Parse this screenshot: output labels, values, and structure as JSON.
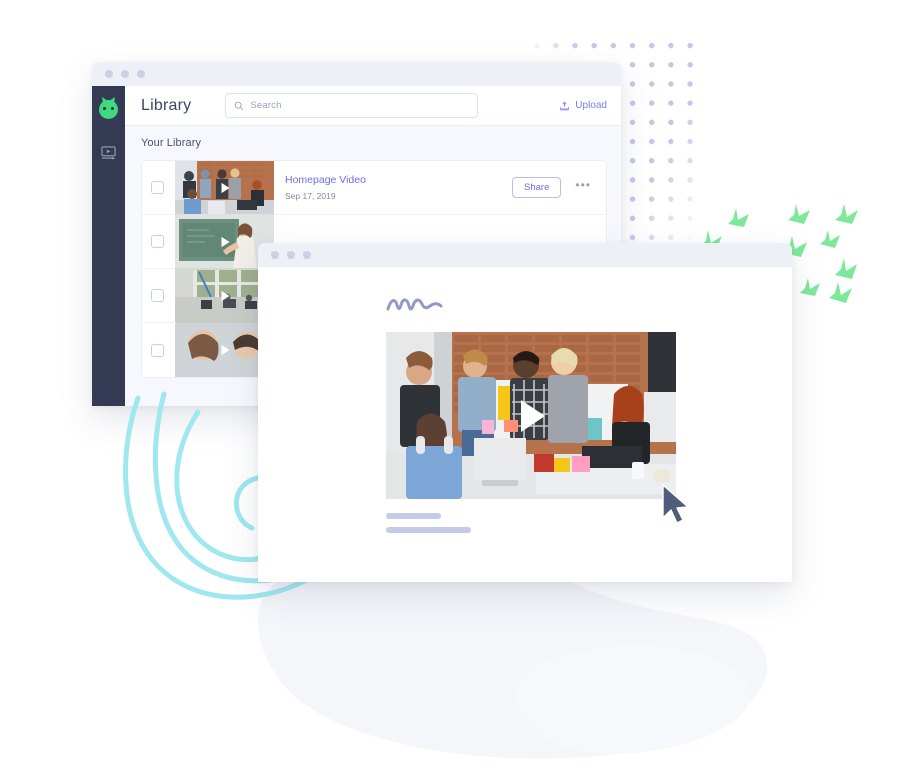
{
  "library_window": {
    "name": "Library app window",
    "titlebar_dots": 3,
    "sidebar": {
      "items": [
        {
          "icon": "app-logo-icon",
          "label": "Vidyard"
        },
        {
          "icon": "video-screen-icon",
          "label": "Videos"
        }
      ]
    },
    "header": {
      "title": "Library",
      "search": {
        "placeholder": "Search",
        "value": "",
        "icon": "search-icon"
      },
      "upload": {
        "label": "Upload",
        "icon": "upload-icon"
      }
    },
    "content": {
      "section_label": "Your Library",
      "rows": [
        {
          "name": "Homepage Video",
          "date": "Sep 17, 2019",
          "share_label": "Share",
          "menu_label": "•••",
          "thumbnail": "office-team-brick-wall",
          "checked": false
        },
        {
          "name": "",
          "date": "",
          "share_label": "",
          "menu_label": "",
          "thumbnail": "presenter-at-chalkboard",
          "checked": false
        },
        {
          "name": "",
          "date": "",
          "share_label": "",
          "menu_label": "",
          "thumbnail": "classroom-desks-windows",
          "checked": false
        },
        {
          "name": "",
          "date": "",
          "share_label": "",
          "menu_label": "",
          "thumbnail": "two-people-portrait",
          "checked": false
        }
      ]
    }
  },
  "player_window": {
    "name": "Video player window",
    "titlebar_dots": 3,
    "brand_mark": "scribble-signature-logo",
    "video": {
      "thumbnail": "office-team-brick-wall",
      "play_icon": "play-triangle-icon"
    },
    "skeleton_bars": 2
  },
  "decorations": {
    "dot_grid": "purple-dot-grid",
    "swirl": "cyan-spiral-swirl",
    "arrows": "green-chevron-arrows",
    "cursor": "mouse-pointer-cursor",
    "blobs": "soft-white-blobs"
  },
  "colors": {
    "accent_purple": "#6b6fe3",
    "sidebar_navy": "#343a54",
    "logo_green": "#41d97f",
    "dot_purple": "#c3c7e4",
    "swirl_cyan": "#9fe8f0",
    "arrow_green": "#7ee89a",
    "cursor_slate": "#515c7a",
    "skeleton_blue": "#c3cbe8",
    "titlebar_bg": "#eef0f8",
    "content_bg": "#f7f8fd"
  }
}
